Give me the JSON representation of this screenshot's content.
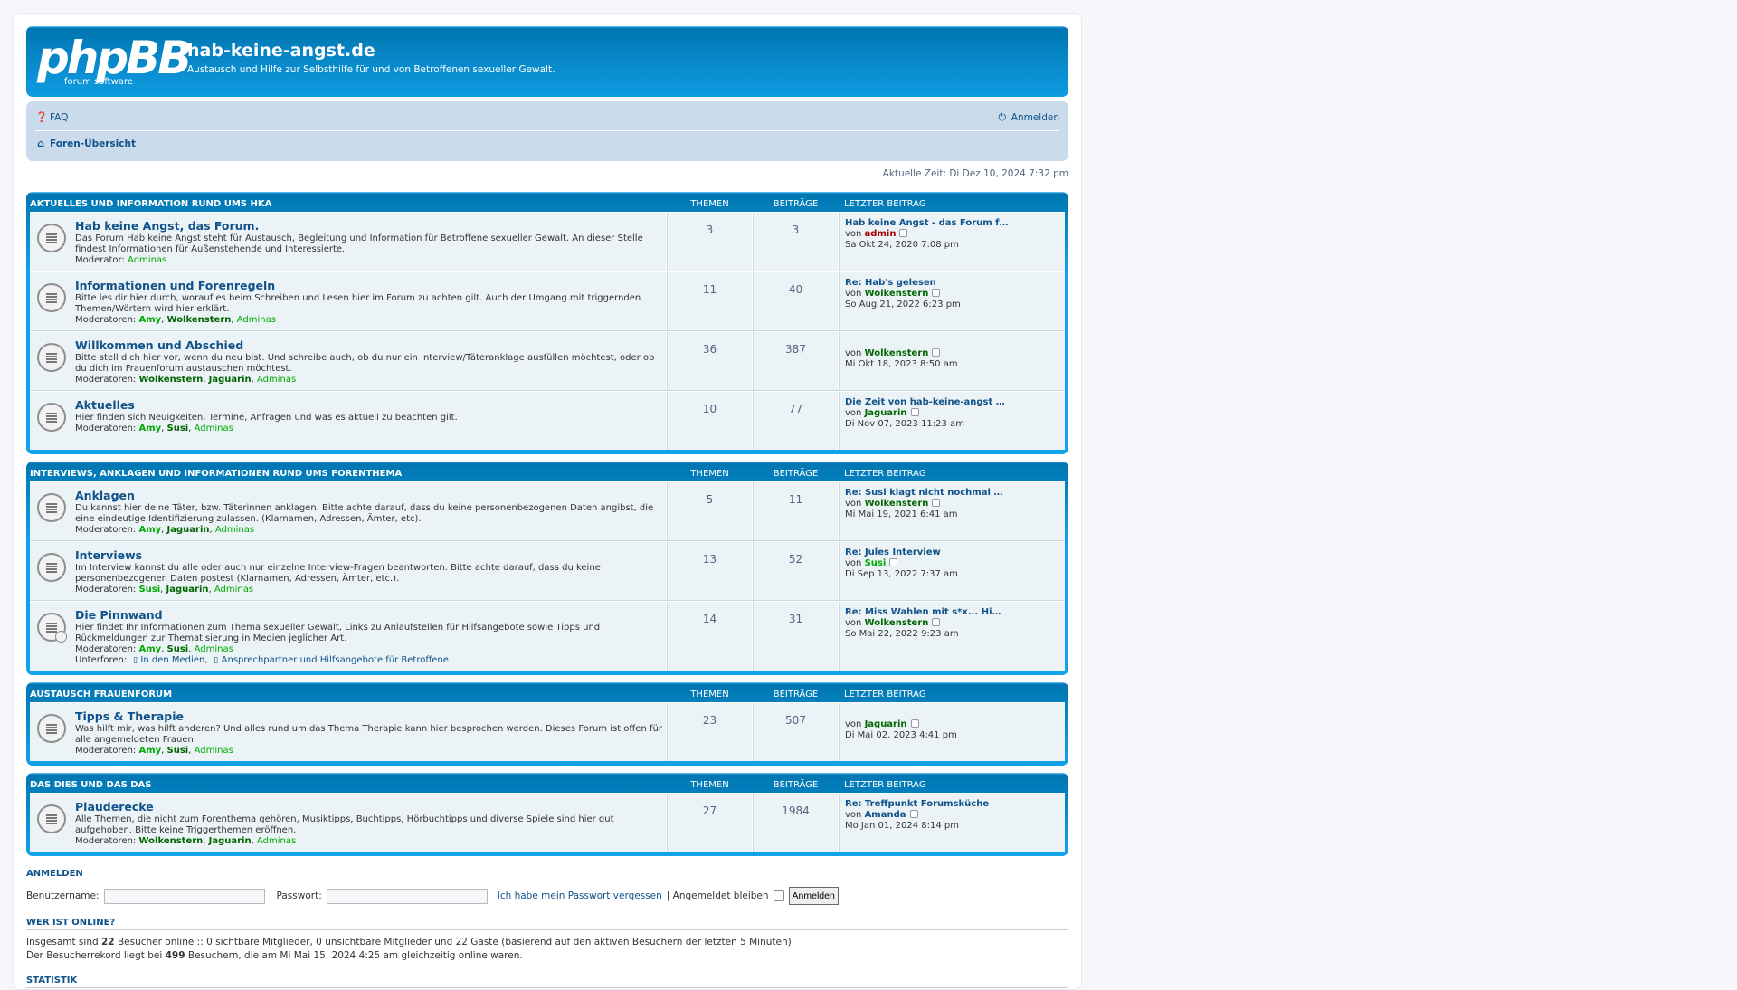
{
  "site": {
    "logo_main": "phpBB",
    "logo_sub": "forum software",
    "title": "hab-keine-angst.de",
    "description": "Austausch und Hilfe zur Selbsthilfe für und von Betroffenen sexueller Gewalt."
  },
  "nav": {
    "faq": "FAQ",
    "login": "Anmelden",
    "breadcrumb": "Foren-Übersicht"
  },
  "time": "Aktuelle Zeit: Di Dez 10, 2024 7:32 pm",
  "col_headers": {
    "topics": "Themen",
    "posts": "Beiträge",
    "last": "Letzter Beitrag"
  },
  "categories": [
    {
      "title": "Aktuelles und Information rund ums HKA",
      "forums": [
        {
          "title": "Hab keine Angst, das Forum.",
          "desc": "Das Forum Hab keine Angst steht für Austausch, Begleitung und Information für Betroffene sexueller Gewalt. An dieser Stelle findest Informationen für Außenstehende und Interessierte.",
          "mods_label": "Moderator:",
          "mods": "Adminas",
          "topics": "3",
          "posts": "3",
          "last_title": "Hab keine Angst - das Forum f…",
          "last_by_label": "von",
          "last_by": "admin",
          "last_date": "Sa Okt 24, 2020 7:08 pm"
        },
        {
          "title": "Informationen und Forenregeln",
          "desc": "Bitte les dir hier durch, worauf es beim Schreiben und Lesen hier im Forum zu achten gilt. Auch der Umgang mit triggernden Themen/Wörtern wird hier erklärt.",
          "mods_label": "Moderatoren:",
          "mod1": "Amy",
          "mod2": "Wolkenstern",
          "mod3": "Adminas",
          "topics": "11",
          "posts": "40",
          "last_title": "Re: Hab's gelesen",
          "last_by_label": "von",
          "last_by": "Wolkenstern",
          "last_date": "So Aug 21, 2022 6:23 pm"
        },
        {
          "title": "Willkommen und Abschied",
          "desc": "Bitte stell dich hier vor, wenn du neu bist. Und schreibe auch, ob du nur ein Interview/Täteranklage ausfüllen möchtest, oder ob du dich im Frauenforum austauschen möchtest.",
          "mods_label": "Moderatoren:",
          "mod1": "Wolkenstern",
          "mod2": "Jaguarin",
          "mod3": "Adminas",
          "topics": "36",
          "posts": "387",
          "last_by_label": "von",
          "last_by": "Wolkenstern",
          "last_date": "Mi Okt 18, 2023 8:50 am"
        },
        {
          "title": "Aktuelles",
          "desc": "Hier finden sich Neuigkeiten, Termine, Anfragen und was es aktuell zu beachten gilt.",
          "mods_label": "Moderatoren:",
          "mod1": "Amy",
          "mod2": "Susi",
          "mod3": "Adminas",
          "topics": "10",
          "posts": "77",
          "last_title": "Die Zeit von hab-keine-angst …",
          "last_by_label": "von",
          "last_by": "Jaguarin",
          "last_date": "Di Nov 07, 2023 11:23 am"
        }
      ]
    },
    {
      "title": "Interviews, Anklagen und Informationen rund ums Forenthema",
      "forums": [
        {
          "title": "Anklagen",
          "desc": "Du kannst hier deine Täter, bzw. Täterinnen anklagen. Bitte achte darauf, dass du keine personenbezogenen Daten angibst, die eine eindeutige Identifizierung zulassen. (Klarnamen, Adressen, Ämter, etc).",
          "mods_label": "Moderatoren:",
          "mod1": "Amy",
          "mod2": "Jaguarin",
          "mod3": "Adminas",
          "topics": "5",
          "posts": "11",
          "last_title": "Re: Susi klagt nicht nochmal …",
          "last_by_label": "von",
          "last_by": "Wolkenstern",
          "last_date": "Mi Mai 19, 2021 6:41 am"
        },
        {
          "title": "Interviews",
          "desc": "Im Interview kannst du alle oder auch nur einzelne Interview-Fragen beantworten. Bitte achte darauf, dass du keine personenbezogenen Daten postest (Klarnamen, Adressen, Ämter, etc.).",
          "mods_label": "Moderatoren:",
          "mod1": "Susi",
          "mod2": "Jaguarin",
          "mod3": "Adminas",
          "topics": "13",
          "posts": "52",
          "last_title": "Re: Jules Interview",
          "last_by_label": "von",
          "last_by": "Susi",
          "last_date": "Di Sep 13, 2022 7:37 am"
        },
        {
          "title": "Die Pinnwand",
          "desc": "Hier findet Ihr Informationen zum Thema sexueller Gewalt, Links zu Anlaufstellen für Hilfsangebote sowie Tipps und Rückmeldungen zur Thematisierung in Medien jeglicher Art.",
          "mods_label": "Moderatoren:",
          "mod1": "Amy",
          "mod2": "Susi",
          "mod3": "Adminas",
          "subforums_label": "Unterforen:",
          "sub1": "In den Medien",
          "sub2": "Ansprechpartner und Hilfsangebote für Betroffene",
          "topics": "14",
          "posts": "31",
          "last_title": "Re: Miss Wahlen mit s*x... Hi…",
          "last_by_label": "von",
          "last_by": "Wolkenstern",
          "last_date": "So Mai 22, 2022 9:23 am"
        }
      ]
    },
    {
      "title": "Austausch Frauenforum",
      "forums": [
        {
          "title": "Tipps & Therapie",
          "desc": "Was hilft mir, was hilft anderen? Und alles rund um das Thema Therapie kann hier besprochen werden. Dieses Forum ist offen für alle angemeldeten Frauen.",
          "mods_label": "Moderatoren:",
          "mod1": "Amy",
          "mod2": "Susi",
          "mod3": "Adminas",
          "topics": "23",
          "posts": "507",
          "last_by_label": "von",
          "last_by": "Jaguarin",
          "last_date": "Di Mai 02, 2023 4:41 pm"
        }
      ]
    },
    {
      "title": "Das dies und das das",
      "forums": [
        {
          "title": "Plauderecke",
          "desc": "Alle Themen, die nicht zum Forenthema gehören, Musiktipps, Buchtipps, Hörbuchtipps und diverse Spiele sind hier gut aufgehoben. Bitte keine Triggerthemen eröffnen.",
          "mods_label": "Moderatoren:",
          "mod1": "Wolkenstern",
          "mod2": "Jaguarin",
          "mod3": "Adminas",
          "topics": "27",
          "posts": "1984",
          "last_title": "Re: Treffpunkt Forumsküche",
          "last_by_label": "von",
          "last_by": "Amanda",
          "last_date": "Mo Jan 01, 2024 8:14 pm"
        }
      ]
    }
  ],
  "login": {
    "heading": "Anmelden",
    "username_label": "Benutzername:",
    "password_label": "Passwort:",
    "forgot": "Ich habe mein Passwort vergessen",
    "remember": "| Angemeldet bleiben",
    "submit": "Anmelden"
  },
  "online": {
    "heading": "Wer ist online?",
    "line1_pre": "Insgesamt sind",
    "line1_count": "22",
    "line1_post": "Besucher online :: 0 sichtbare Mitglieder, 0 unsichtbare Mitglieder und 22 Gäste (basierend auf den aktiven Besuchern der letzten 5 Minuten)",
    "line2_pre": "Der Besucherrekord liegt bei",
    "line2_count": "499",
    "line2_post": "Besuchern, die am Mi Mai 15, 2024 4:25 am gleichzeitig online waren."
  },
  "stats_heading": "Statistik",
  "colors": {
    "header_blue": "#12a3eb",
    "nav_bg": "#cadceb",
    "row_bg": "#ecf3f7",
    "link": "#105289",
    "mod_green": "#00aa00",
    "admin_red": "#aa0000"
  }
}
